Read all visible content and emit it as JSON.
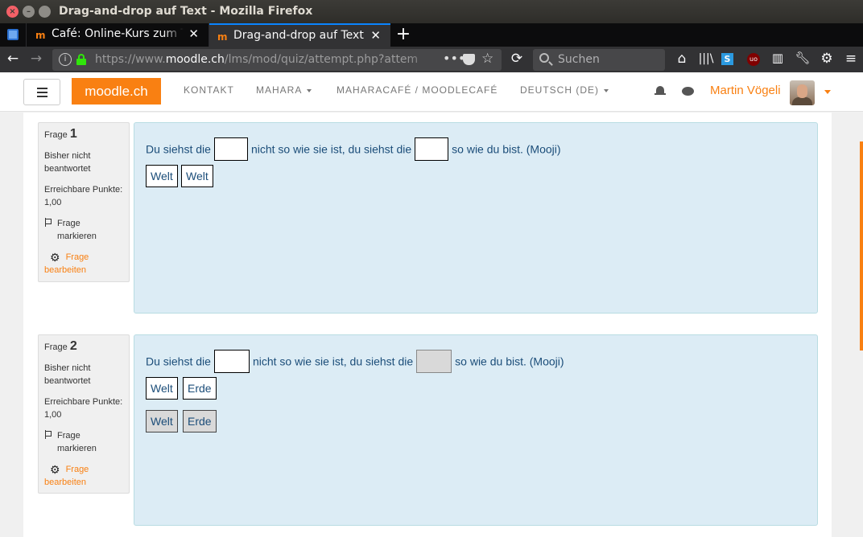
{
  "window": {
    "title": "Drag-and-drop auf Text - Mozilla Firefox"
  },
  "tabs": [
    {
      "label": "Café: Online-Kurs zum Th",
      "favicon": "moodle-m-icon",
      "active": false
    },
    {
      "label": "Drag-and-drop auf Text",
      "favicon": "moodle-m-icon",
      "active": true
    }
  ],
  "navbar": {
    "url_prefix": "https://www.",
    "url_domain": "moodle.ch",
    "url_path": "/lms/mod/quiz/attempt.php?attem",
    "search_placeholder": "Suchen"
  },
  "site": {
    "brand": "moodle.ch",
    "menu": [
      {
        "label": "KONTAKT",
        "dropdown": false
      },
      {
        "label": "MAHARA",
        "dropdown": true
      },
      {
        "label": "MAHARACAFÉ / MOODLECAFÉ",
        "dropdown": false
      },
      {
        "label": "DEUTSCH (DE)",
        "dropdown": true
      }
    ],
    "user_name": "Martin Vögeli",
    "accent": "#f98012"
  },
  "questions": [
    {
      "label": "Frage",
      "number": "1",
      "status": "Bisher nicht beantwortet",
      "points_label": "Erreichbare Punkte:",
      "points": "1,00",
      "flag_label": "Frage markieren",
      "edit_label": "Frage bearbeiten",
      "text_parts": [
        "Du siehst die",
        "nicht so wie sie ist, du siehst die",
        "so wie du bist. (Mooji)"
      ],
      "choices_row1": [
        "Welt",
        "Welt"
      ]
    },
    {
      "label": "Frage",
      "number": "2",
      "status": "Bisher nicht beantwortet",
      "points_label": "Erreichbare Punkte:",
      "points": "1,00",
      "flag_label": "Frage markieren",
      "edit_label": "Frage bearbeiten",
      "text_parts": [
        "Du siehst die",
        "nicht so wie sie ist, du siehst die",
        "so wie du bist. (Mooji)"
      ],
      "choices_row1": [
        "Welt",
        "Erde"
      ],
      "choices_row2": [
        "Welt",
        "Erde"
      ]
    }
  ]
}
